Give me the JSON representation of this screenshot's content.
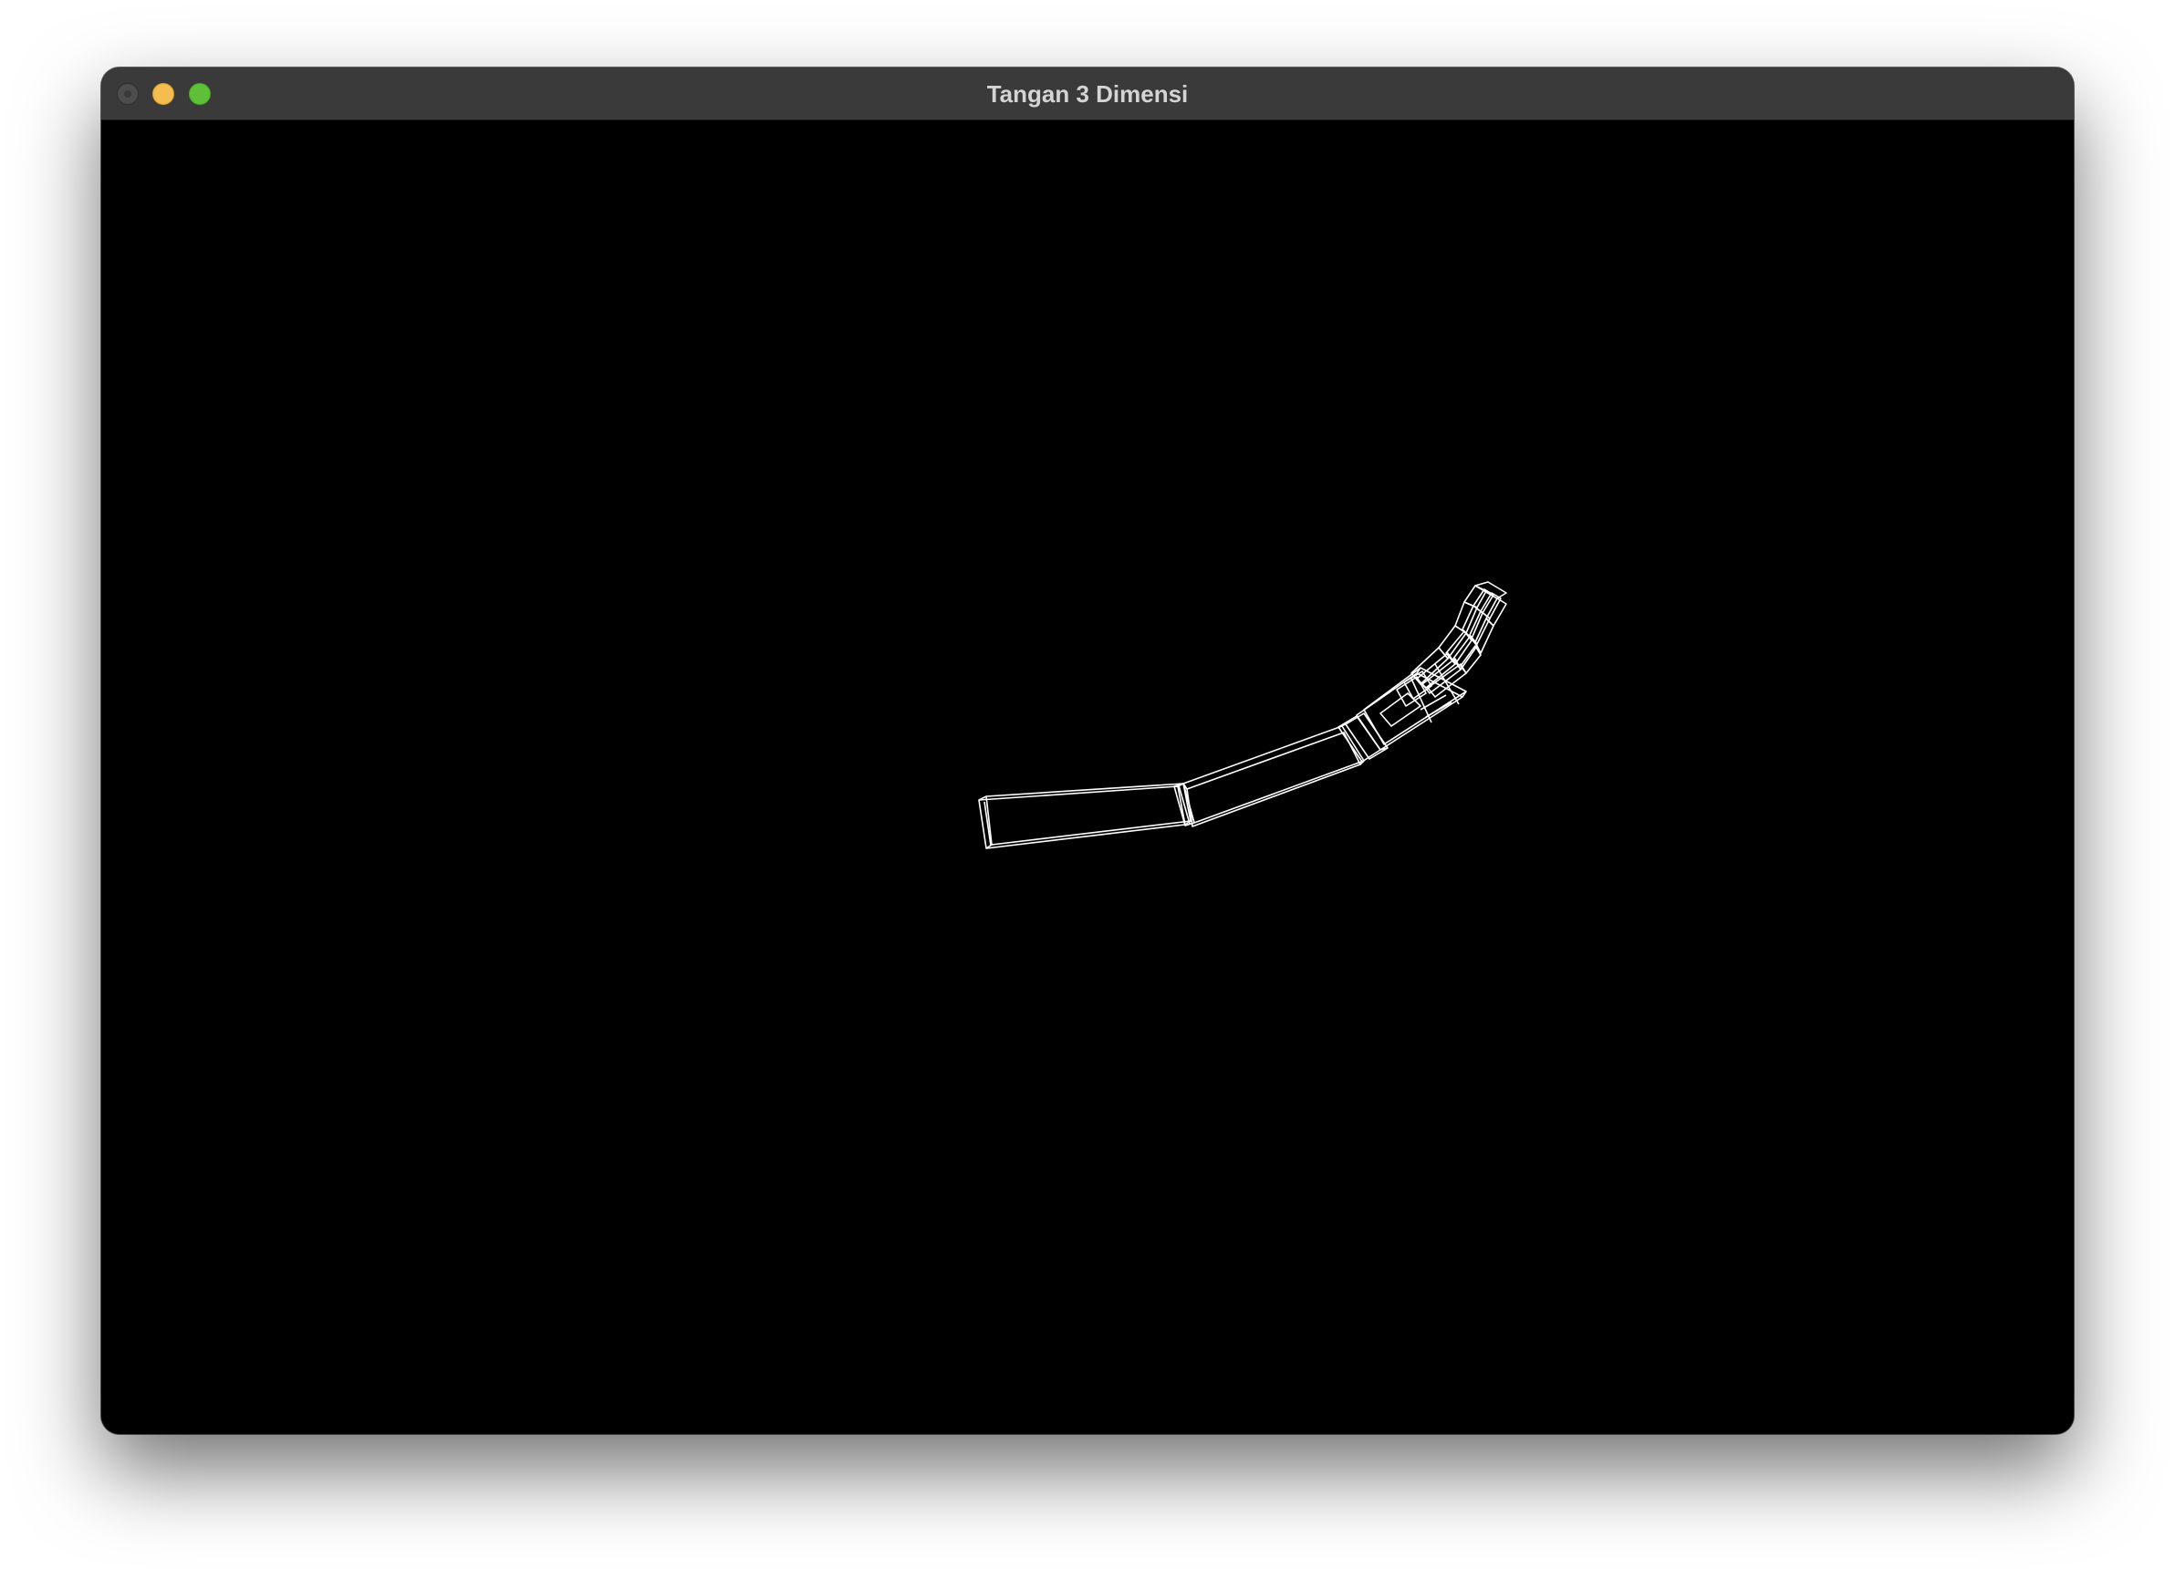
{
  "window": {
    "title": "Tangan 3 Dimensi",
    "background_color": "#000000",
    "titlebar_color": "#3a3a3a"
  },
  "traffic_lights": {
    "close": {
      "icon": "close-dot-icon",
      "color": "#4d4d4d"
    },
    "minimize": {
      "icon": "minimize-dot-icon",
      "color": "#f5bd4f"
    },
    "maximize": {
      "icon": "maximize-dot-icon",
      "color": "#5fc038"
    }
  },
  "scene": {
    "render_mode": "wireframe",
    "line_color": "#ffffff",
    "parts": [
      "upper-arm",
      "forearm",
      "wrist",
      "palm",
      "fingers"
    ]
  }
}
